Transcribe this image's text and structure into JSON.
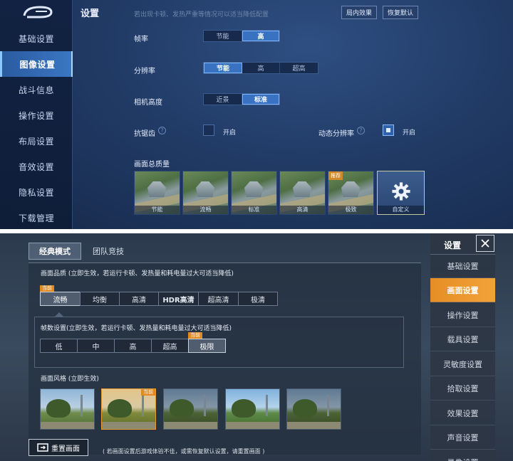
{
  "top": {
    "sidebar": {
      "items": [
        {
          "label": "基础设置"
        },
        {
          "label": "图像设置"
        },
        {
          "label": "战斗信息"
        },
        {
          "label": "操作设置"
        },
        {
          "label": "布局设置"
        },
        {
          "label": "音效设置"
        },
        {
          "label": "隐私设置"
        },
        {
          "label": "下载管理"
        }
      ],
      "active_index": 1
    },
    "header": {
      "title": "设置",
      "hint": "若出现卡顿、发热严重等情况可以适当降低配置",
      "btn_effect": "局内效果",
      "btn_reset": "恢复默认"
    },
    "frame_rate": {
      "label": "帧率",
      "options": [
        "节能",
        "高"
      ],
      "selected": "高"
    },
    "resolution": {
      "label": "分辨率",
      "options": [
        "节能",
        "高",
        "超高"
      ],
      "selected": "节能"
    },
    "camera": {
      "label": "相机高度",
      "options": [
        "近景",
        "标准"
      ],
      "selected": "标准"
    },
    "aa": {
      "label": "抗锯齿",
      "toggle_label": "开启",
      "checked": false
    },
    "dynres": {
      "label": "动态分辨率",
      "toggle_label": "开启",
      "checked": true
    },
    "quality": {
      "label": "画面总质量",
      "presets": [
        {
          "caption": "节能"
        },
        {
          "caption": "流畅"
        },
        {
          "caption": "标准"
        },
        {
          "caption": "高清"
        },
        {
          "caption": "极致",
          "badge": "推荐"
        },
        {
          "caption": "自定义"
        }
      ]
    }
  },
  "bottom": {
    "tabs": [
      "经典模式",
      "团队竞技"
    ],
    "active_tab": 0,
    "quality": {
      "label": "画面品质 (立即生效，若运行卡顿、发热量和耗电量过大可适当降低)",
      "options": [
        "流畅",
        "均衡",
        "高清",
        "HDR高清",
        "超高清",
        "极清"
      ],
      "selected": "流畅",
      "current_badge": "当前"
    },
    "fps": {
      "label": "帧数设置(立即生效，若运行卡顿、发热量和耗电量过大可适当降低)",
      "options": [
        "低",
        "中",
        "高",
        "超高",
        "极限"
      ],
      "selected": "极限",
      "current_badge": "当前"
    },
    "style": {
      "label": "画面风格 (立即生效)",
      "current_badge": "当前",
      "selected_index": 1
    },
    "reset_button": "重置画面",
    "reset_note": "( 若画面设置后游戏体验不佳，或需恢复默认设置，请重置画面 )",
    "side": {
      "title": "设置",
      "items": [
        "基础设置",
        "画面设置",
        "操作设置",
        "载具设置",
        "灵敏度设置",
        "拾取设置",
        "效果设置",
        "声音设置",
        "录像设置"
      ],
      "active_index": 1
    }
  },
  "colors": {
    "top_active": "#3a72c2",
    "bottom_accent": "#e58e24"
  }
}
